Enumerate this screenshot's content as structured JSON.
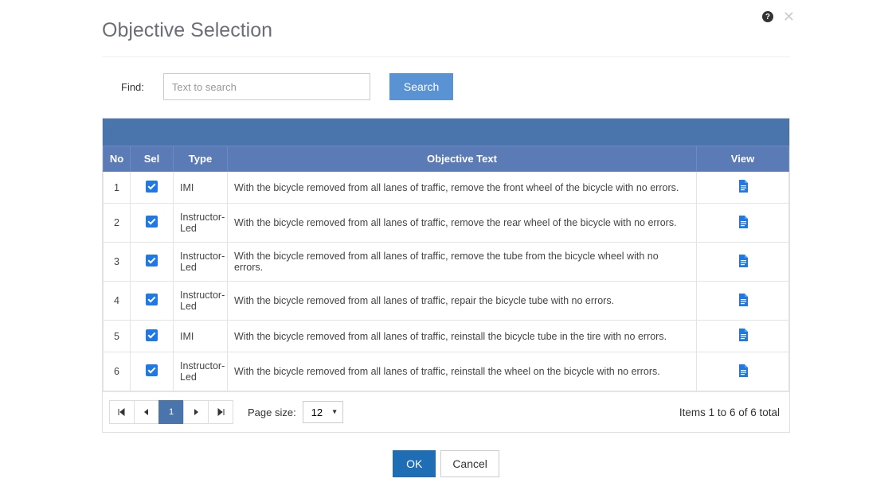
{
  "title": "Objective Selection",
  "search": {
    "label": "Find:",
    "placeholder": "Text to search",
    "button": "Search"
  },
  "table": {
    "headers": {
      "no": "No",
      "sel": "Sel",
      "type": "Type",
      "text": "Objective Text",
      "view": "View"
    },
    "rows": [
      {
        "no": "1",
        "selected": true,
        "type": "IMI",
        "text": "With the bicycle removed from all lanes of traffic, remove the front wheel of the bicycle with no errors."
      },
      {
        "no": "2",
        "selected": true,
        "type": "Instructor-Led",
        "text": "With the bicycle removed from all lanes of traffic, remove the rear wheel of the bicycle with no errors."
      },
      {
        "no": "3",
        "selected": true,
        "type": "Instructor-Led",
        "text": "With the bicycle removed from all lanes of traffic, remove the tube from the bicycle wheel with no errors."
      },
      {
        "no": "4",
        "selected": true,
        "type": "Instructor-Led",
        "text": "With the bicycle removed from all lanes of traffic, repair the bicycle tube with no errors."
      },
      {
        "no": "5",
        "selected": true,
        "type": "IMI",
        "text": "With the bicycle removed from all lanes of traffic, reinstall the bicycle tube in the tire with no errors."
      },
      {
        "no": "6",
        "selected": true,
        "type": "Instructor-Led",
        "text": "With the bicycle removed from all lanes of traffic, reinstall the wheel on the bicycle with no errors."
      }
    ]
  },
  "pager": {
    "page": "1",
    "page_size_label": "Page size:",
    "page_size": "12",
    "items_info": "Items 1 to 6 of 6 total"
  },
  "footer": {
    "ok": "OK",
    "cancel": "Cancel"
  }
}
